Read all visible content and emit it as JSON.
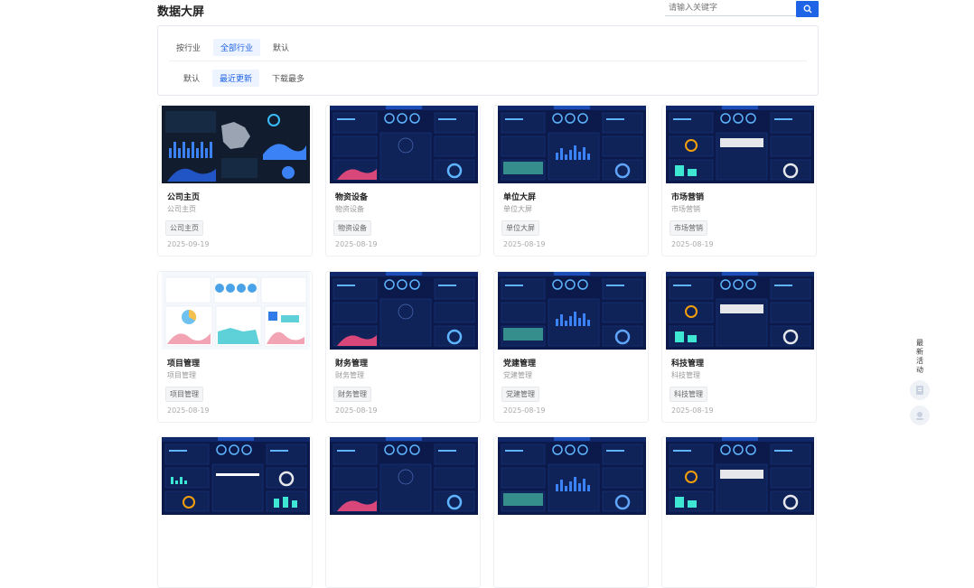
{
  "page": {
    "title": "数据大屏"
  },
  "search": {
    "placeholder": "请输入关键字"
  },
  "filters": {
    "industry": [
      "按行业",
      "全部行业",
      "默认"
    ],
    "sort": [
      "默认",
      "最近更新",
      "下载最多"
    ],
    "industry_active": 1,
    "sort_active": 1
  },
  "cards": [
    {
      "name": "公司主页",
      "sub": "公司主页",
      "tag": "公司主页",
      "date": "2025-09-19",
      "theme": "dark-map"
    },
    {
      "name": "物资设备",
      "sub": "物资设备",
      "tag": "物资设备",
      "date": "2025-08-19",
      "theme": "navy"
    },
    {
      "name": "单位大屏",
      "sub": "单位大屏",
      "tag": "单位大屏",
      "date": "2025-08-19",
      "theme": "navy"
    },
    {
      "name": "市场营销",
      "sub": "市场营销",
      "tag": "市场营销",
      "date": "2025-08-19",
      "theme": "navy"
    },
    {
      "name": "项目管理",
      "sub": "项目管理",
      "tag": "项目管理",
      "date": "2025-08-19",
      "theme": "light"
    },
    {
      "name": "财务管理",
      "sub": "财务管理",
      "tag": "财务管理",
      "date": "2025-08-19",
      "theme": "navy"
    },
    {
      "name": "党建管理",
      "sub": "党建管理",
      "tag": "党建管理",
      "date": "2025-08-19",
      "theme": "navy"
    },
    {
      "name": "科技管理",
      "sub": "科技管理",
      "tag": "科技管理",
      "date": "2025-08-19",
      "theme": "navy"
    },
    {
      "name": "",
      "sub": "",
      "tag": "",
      "date": "",
      "theme": "navy"
    },
    {
      "name": "",
      "sub": "",
      "tag": "",
      "date": "",
      "theme": "navy"
    },
    {
      "name": "",
      "sub": "",
      "tag": "",
      "date": "",
      "theme": "navy"
    },
    {
      "name": "",
      "sub": "",
      "tag": "",
      "date": "",
      "theme": "navy"
    }
  ],
  "side": {
    "label": "最新活动",
    "icons": [
      "document-icon",
      "headset-icon"
    ]
  },
  "colors": {
    "accent": "#1f63e6",
    "navy": "#0b1a4a",
    "cyan": "#3ee6d4"
  }
}
